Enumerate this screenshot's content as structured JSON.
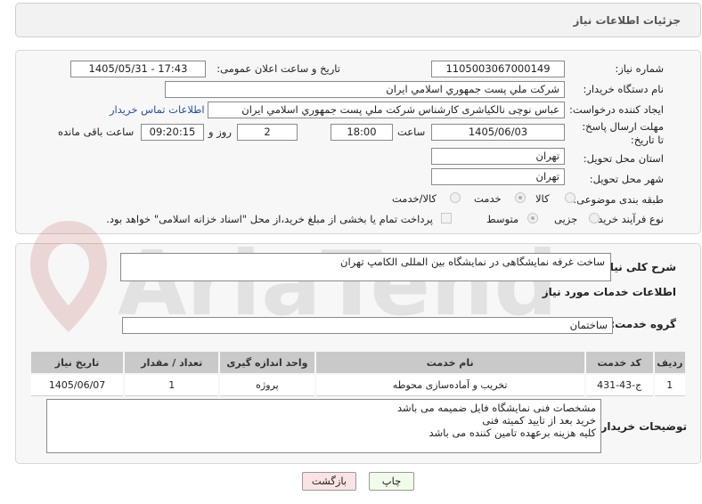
{
  "header": {
    "title": "جزئیات اطلاعات نیاز"
  },
  "form": {
    "need_number_label": "شماره نیاز:",
    "need_number": "1105003067000149",
    "announce_label": "تاریخ و ساعت اعلان عمومی:",
    "announce_value": "1405/05/31 - 17:43",
    "buyer_org_label": "نام دستگاه خریدار:",
    "buyer_org": "شرکت ملي پست جمهوري اسلامي ايران",
    "creator_label": "ایجاد کننده درخواست:",
    "creator": "عباس نوچی نالکیاشری کارشناس شرکت ملي پست جمهوري اسلامي ايران",
    "contact_link": "اطلاعات تماس خریدار",
    "deadline_label": "مهلت ارسال پاسخ: تا تاریخ:",
    "deadline_date": "1405/06/03",
    "time_label": "ساعت",
    "deadline_time": "18:00",
    "days_value": "2",
    "days_label": "روز و",
    "remaining_time": "09:20:15",
    "remaining_label": "ساعت باقی مانده",
    "province_label": "استان محل تحویل:",
    "province": "تهران",
    "city_label": "شهر محل تحویل:",
    "city": "تهران",
    "category_label": "طبقه بندی موضوعی:",
    "category_options": [
      "کالا",
      "خدمت",
      "کالا/خدمت"
    ],
    "category_selected": "خدمت",
    "process_label": "نوع فرآیند خرید :",
    "process_options": [
      "جزیی",
      "متوسط"
    ],
    "process_selected": "متوسط",
    "payment_note": "پرداخت تمام یا بخشی از مبلغ خرید،از محل \"اسناد خزانه اسلامی\" خواهد بود."
  },
  "summary": {
    "label": "شرح کلی نیاز:",
    "text": "ساخت غرفه نمایشگاهی در نمایشگاه بین المللی الکامپ تهران"
  },
  "services": {
    "section_title": "اطلاعات خدمات مورد نیاز",
    "group_label": "گروه خدمت:",
    "group_value": "ساختمان",
    "columns": [
      "ردیف",
      "کد خدمت",
      "نام خدمت",
      "واحد اندازه گیری",
      "تعداد / مقدار",
      "تاریخ نیاز"
    ],
    "rows": [
      {
        "row": "1",
        "code": "ج-43-431",
        "name": "تخریب و آماده‌سازی محوطه",
        "unit": "پروژه",
        "qty": "1",
        "date": "1405/06/07"
      }
    ]
  },
  "buyer_notes": {
    "label": "توضیحات خریدار:",
    "lines": [
      "مشخصات فنی نمایشگاه فایل ضمیمه می باشد",
      "خرید بعد از تایید کمیته فنی",
      "کلیه هزینه برعهده تامین کننده می باشد"
    ]
  },
  "buttons": {
    "print": "چاپ",
    "back": "بازگشت"
  },
  "watermark": {
    "text": "AriaTender.net"
  },
  "colors": {
    "link": "#2a4f9a",
    "table_header": "#c9c9c9",
    "back_button": "#fbe3e3",
    "print_button": "#f1fbe9"
  }
}
